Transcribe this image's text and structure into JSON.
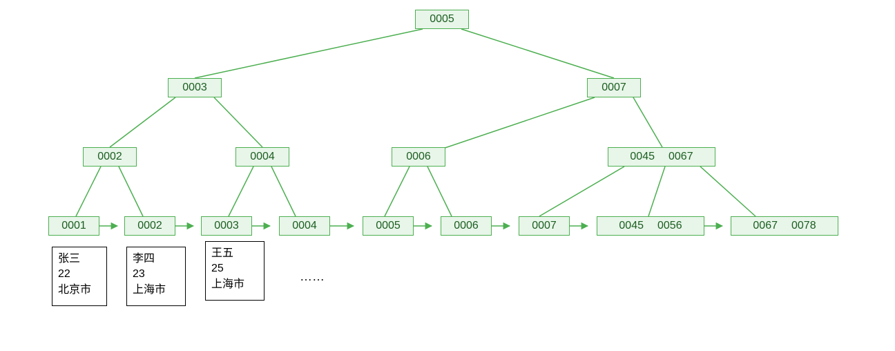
{
  "tree": {
    "root": {
      "keys": [
        "0005"
      ]
    },
    "level1": {
      "left": {
        "keys": [
          "0003"
        ]
      },
      "right": {
        "keys": [
          "0007"
        ]
      }
    },
    "level2": {
      "n0": {
        "keys": [
          "0002"
        ]
      },
      "n1": {
        "keys": [
          "0004"
        ]
      },
      "n2": {
        "keys": [
          "0006"
        ]
      },
      "n3": {
        "keys": [
          "0045",
          "0067"
        ]
      }
    },
    "leaves": {
      "l0": {
        "keys": [
          "0001"
        ]
      },
      "l1": {
        "keys": [
          "0002"
        ]
      },
      "l2": {
        "keys": [
          "0003"
        ]
      },
      "l3": {
        "keys": [
          "0004"
        ]
      },
      "l4": {
        "keys": [
          "0005"
        ]
      },
      "l5": {
        "keys": [
          "0006"
        ]
      },
      "l6": {
        "keys": [
          "0007"
        ]
      },
      "l7": {
        "keys": [
          "0045",
          "0056"
        ]
      },
      "l8": {
        "keys": [
          "0067",
          "0078"
        ]
      }
    }
  },
  "records": {
    "r0": {
      "name": "张三",
      "age": "22",
      "city": "北京市"
    },
    "r1": {
      "name": "李四",
      "age": "23",
      "city": "上海市"
    },
    "r2": {
      "name": "王五",
      "age": "25",
      "city": "上海市"
    }
  },
  "ellipsis": "……",
  "colors": {
    "node_border": "#4CAF50",
    "node_fill": "#E8F5E9",
    "node_text": "#1B5E20",
    "edge": "#4CAF50"
  }
}
